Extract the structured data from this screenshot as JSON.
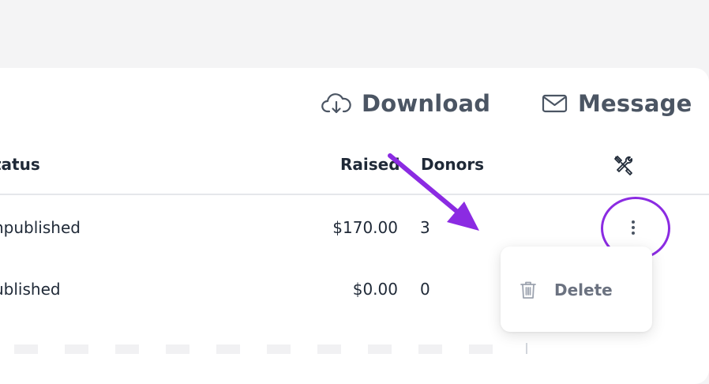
{
  "toolbar": {
    "download_label": "Download",
    "message_label": "Message"
  },
  "table": {
    "headers": {
      "status": "tatus",
      "raised": "Raised",
      "donors": "Donors",
      "actions_icon": "tools-icon"
    },
    "rows": [
      {
        "status": "npublished",
        "raised": "$170.00",
        "donors": "3"
      },
      {
        "status": "ublished",
        "raised": "$0.00",
        "donors": "0"
      }
    ]
  },
  "row_menu": {
    "delete_label": "Delete",
    "delete_icon": "trash-icon"
  },
  "annotation": {
    "color": "#8b2be2"
  }
}
